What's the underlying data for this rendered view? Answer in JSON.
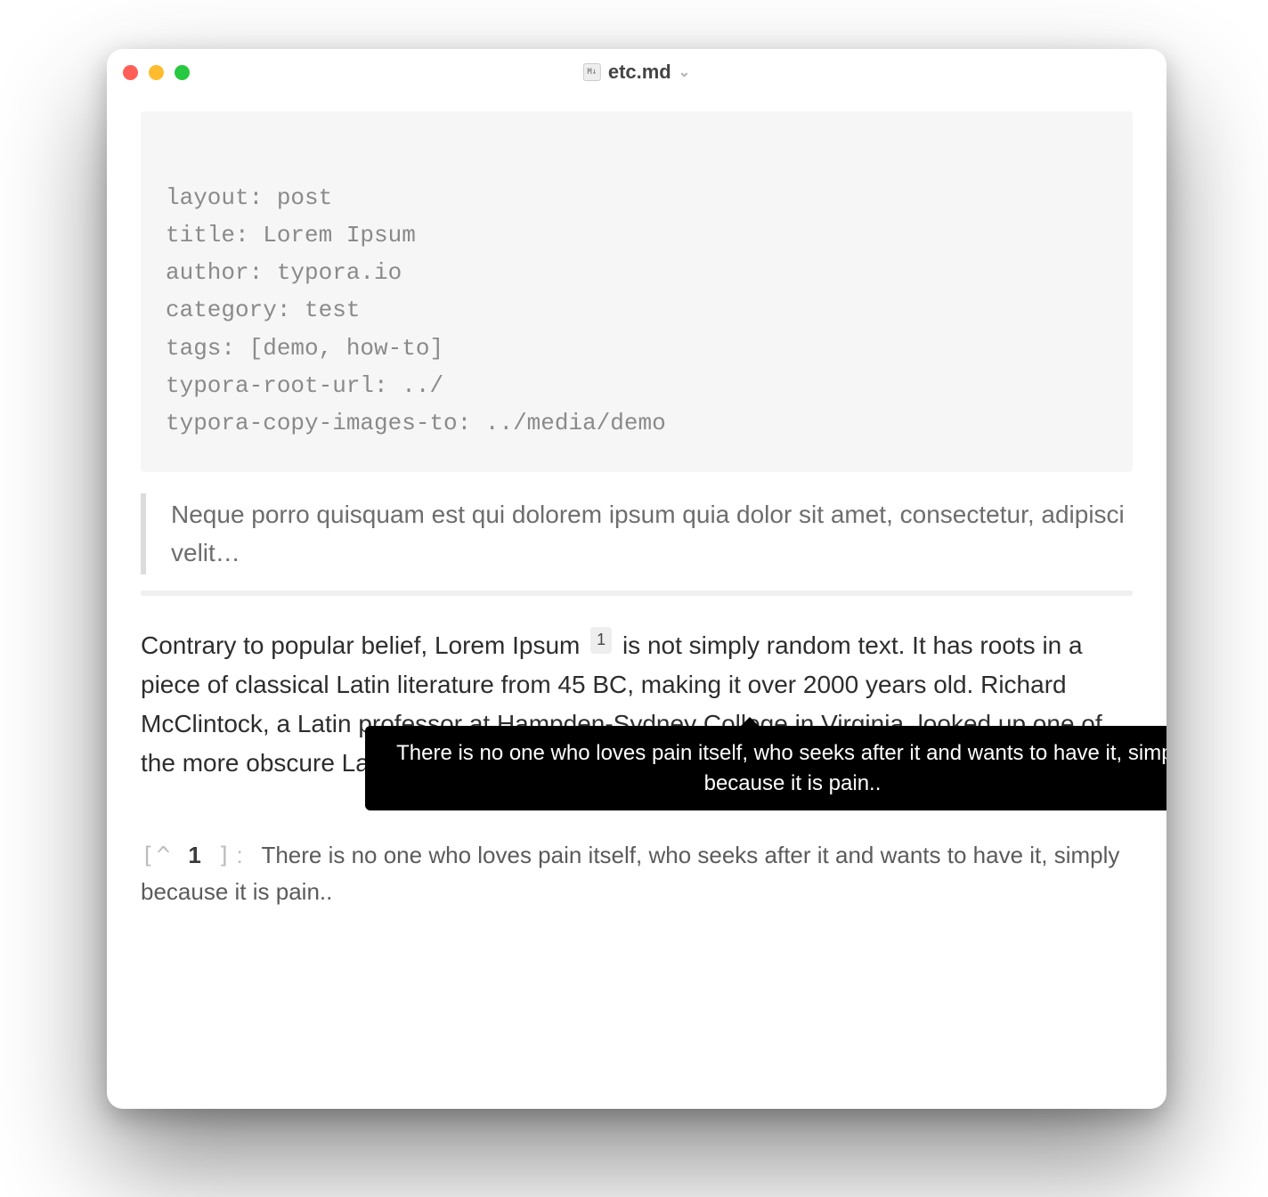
{
  "titlebar": {
    "filename": "etc.md",
    "icon_label": "M↓"
  },
  "frontmatter": {
    "lines": [
      "layout: post",
      "title: Lorem Ipsum",
      "author: typora.io",
      "category: test",
      "tags: [demo, how-to]",
      "typora-root-url: ../",
      "typora-copy-images-to: ../media/demo"
    ]
  },
  "blockquote": "Neque porro quisquam est qui dolorem ipsum quia dolor sit amet, consectetur, adipisci velit…",
  "body": {
    "before_ref": "Contrary to popular belief, Lorem Ipsum",
    "ref": "1",
    "after_ref": " is not simply random text. It has roots in a piece of classical Latin literature from 45 BC, making it over 2000 years old. Richard McClintock, a Latin professor at Hampden-Sydney College in Virginia, looked up one of the more obscure Latin words, consectetur."
  },
  "tooltip": "There is no one who loves pain itself, who seeks after it and wants to have it, simply because it is pain..",
  "footnote": {
    "open": "[^",
    "num": "1",
    "close": "]",
    "colon": ":",
    "text": "There is no one who loves pain itself, who seeks after it and wants to have it, simply because it is pain.."
  }
}
